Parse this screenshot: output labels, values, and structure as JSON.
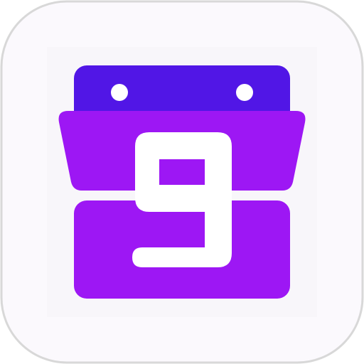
{
  "app_icon": {
    "icon": "calendar-flip-icon",
    "date_digit": "9",
    "colors": {
      "page_background": "#ffffff",
      "tile_fill": "#fbf9fd",
      "tile_border": "#d8d8d8",
      "inner_panel": "#f8f6fa",
      "header_bar": "#5116e6",
      "calendar_body": "#9d17f4",
      "ring_dots": "#ffffff",
      "digit_fill": "#ffffff"
    }
  }
}
